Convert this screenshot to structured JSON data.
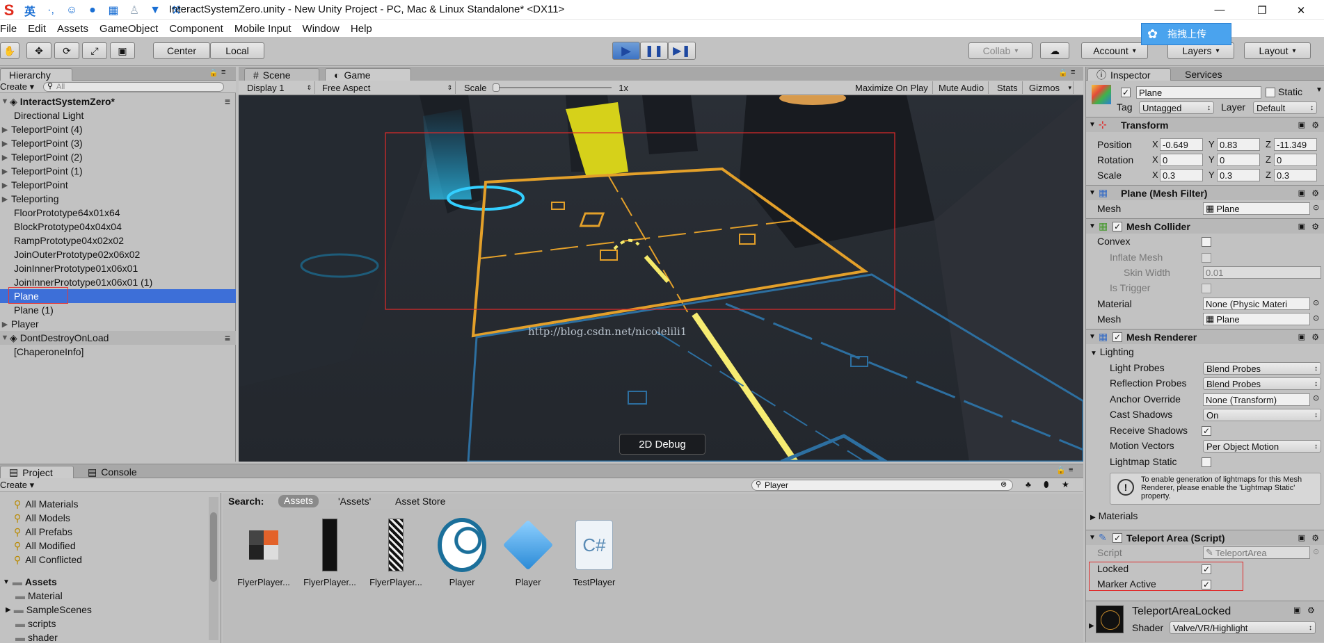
{
  "ime": {
    "logo": "S",
    "lang": "英",
    "punct": "·,"
  },
  "window": {
    "title": "InteractSystemZero.unity - New Unity Project - PC, Mac & Linux Standalone* <DX11>",
    "min": "—",
    "max": "❐",
    "close": "✕"
  },
  "menu": [
    "File",
    "Edit",
    "Assets",
    "GameObject",
    "Component",
    "Mobile Input",
    "Window",
    "Help"
  ],
  "toolbar": {
    "center": "Center",
    "local": "Local",
    "collab": "Collab",
    "account": "Account",
    "layers": "Layers",
    "layout": "Layout",
    "upload": "拖拽上传"
  },
  "hierarchy": {
    "tab": "Hierarchy",
    "create": "Create",
    "search_placeholder": "All",
    "scene": "InteractSystemZero*",
    "items": [
      "Directional Light",
      "TeleportPoint (4)",
      "TeleportPoint (3)",
      "TeleportPoint (2)",
      "TeleportPoint (1)",
      "TeleportPoint",
      "Teleporting",
      "FloorPrototype64x01x64",
      "BlockPrototype04x04x04",
      "RampPrototype04x02x02",
      "JoinOuterPrototype02x06x02",
      "JoinInnerPrototype01x06x01",
      "JoinInnerPrototype01x06x01 (1)",
      "Plane",
      "Plane (1)",
      "Player"
    ],
    "dont_destroy": "DontDestroyOnLoad",
    "chaperone": "[ChaperoneInfo]"
  },
  "scene_tabs": {
    "scene": "Scene",
    "game": "Game"
  },
  "game_toolbar": {
    "display": "Display 1",
    "aspect": "Free Aspect",
    "scale_label": "Scale",
    "scale_value": "1x",
    "maximize": "Maximize On Play",
    "mute": "Mute Audio",
    "stats": "Stats",
    "gizmos": "Gizmos"
  },
  "game": {
    "debug_button": "2D Debug",
    "watermark": "http://blog.csdn.net/nicolelili1"
  },
  "inspector": {
    "tab": "Inspector",
    "services": "Services",
    "object_name": "Plane",
    "static": "Static",
    "tag_label": "Tag",
    "tag": "Untagged",
    "layer_label": "Layer",
    "layer": "Default",
    "transform": {
      "title": "Transform",
      "position": "Position",
      "rotation": "Rotation",
      "scale": "Scale",
      "pos": [
        "-0.649",
        "0.83",
        "-11.349"
      ],
      "rot": [
        "0",
        "0",
        "0"
      ],
      "scl": [
        "0.3",
        "0.3",
        "0.3"
      ]
    },
    "mesh_filter": {
      "title": "Plane (Mesh Filter)",
      "mesh_label": "Mesh",
      "mesh": "Plane"
    },
    "mesh_collider": {
      "title": "Mesh Collider",
      "convex": "Convex",
      "inflate": "Inflate Mesh",
      "skin_label": "Skin Width",
      "skin": "0.01",
      "trigger": "Is Trigger",
      "material_label": "Material",
      "material": "None (Physic Materi",
      "mesh_label": "Mesh",
      "mesh": "Plane"
    },
    "mesh_renderer": {
      "title": "Mesh Renderer",
      "lighting": "Lighting",
      "light_probes_label": "Light Probes",
      "light_probes": "Blend Probes",
      "reflection_label": "Reflection Probes",
      "reflection": "Blend Probes",
      "anchor_label": "Anchor Override",
      "anchor": "None (Transform)",
      "cast_label": "Cast Shadows",
      "cast": "On",
      "receive": "Receive Shadows",
      "motion_label": "Motion Vectors",
      "motion": "Per Object Motion",
      "lightmap": "Lightmap Static",
      "info": "To enable generation of lightmaps for this Mesh Renderer, please enable the 'Lightmap Static' property.",
      "materials": "Materials"
    },
    "teleport": {
      "title": "Teleport Area (Script)",
      "script_label": "Script",
      "script": "TeleportArea",
      "locked": "Locked",
      "marker": "Marker Active"
    },
    "material": {
      "name": "TeleportAreaLocked",
      "shader_label": "Shader",
      "shader": "Valve/VR/Highlight"
    }
  },
  "project": {
    "tab": "Project",
    "console": "Console",
    "create": "Create",
    "search": "Player",
    "favorites": [
      "All Materials",
      "All Models",
      "All Prefabs",
      "All Modified",
      "All Conflicted"
    ],
    "assets_root": "Assets",
    "folders": [
      "Material",
      "SampleScenes",
      "scripts",
      "shader"
    ],
    "search_label": "Search:",
    "scope_assets": "Assets",
    "scope_quoted": "'Assets'",
    "scope_store": "Asset Store",
    "assets": [
      "FlyerPlayer...",
      "FlyerPlayer...",
      "FlyerPlayer...",
      "Player",
      "Player",
      "TestPlayer"
    ]
  }
}
